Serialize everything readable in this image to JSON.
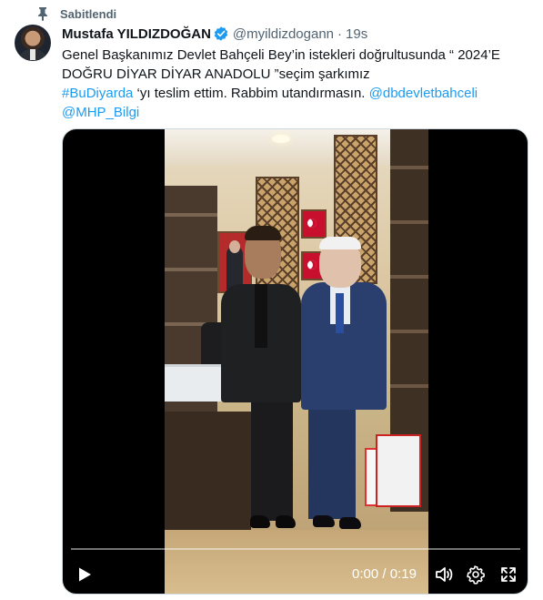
{
  "pinned": {
    "label": "Sabitlendi",
    "icon": "pin-icon"
  },
  "author": {
    "display_name": "Mustafa YILDIZDOĞAN",
    "handle": "@myildizdogann",
    "separator": "·",
    "time": "19s",
    "verified": true,
    "avatar": "avatar"
  },
  "tweet": {
    "line1": "Genel Başkanımız Devlet Bahçeli Bey’in istekleri doğrultusunda “ 2024’E",
    "line2": "DOĞRU DİYAR DİYAR ANADOLU ”seçim şarkımız",
    "hashtag": "#BuDiyarda",
    "line3_rest": " ‘yı teslim ettim. Rabbim utandırmasın. ",
    "mention1": "@dbdevletbahceli",
    "mention2": "@MHP_Bilgi"
  },
  "video": {
    "current_time": "0:00",
    "separator": " / ",
    "duration": "0:19",
    "progress": 0.0,
    "controls": [
      "play-icon",
      "volume-icon",
      "settings-icon",
      "fullscreen-icon"
    ]
  },
  "colors": {
    "accent": "#1d9bf0",
    "text": "#0f1419",
    "secondary": "#536471",
    "video_bg": "#000000"
  }
}
